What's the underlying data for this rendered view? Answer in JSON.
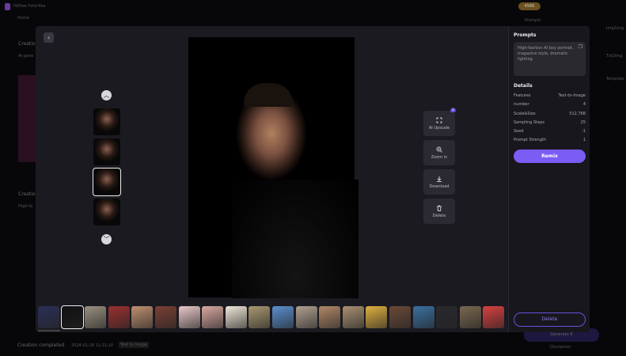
{
  "app": {
    "title": "HitPaw FotorPea",
    "coins": "4566",
    "home": "Home",
    "prompts_bg": "Prompts",
    "img2img": "Img2img",
    "txt2img": "Txt2img",
    "template": "Template",
    "generate": "Generate",
    "generate_cost": "8",
    "disclaimer": "Disclaimer",
    "creation1": "Creation",
    "creation1_sub": "AI-gene",
    "creation2": "Creation",
    "creation2_sub": "High-fa",
    "status": "Creation completed",
    "status_time": "2024-01-28 11:21:10",
    "status_tag": "Text to Image"
  },
  "viewer": {
    "actions": [
      {
        "label": "AI Upscale",
        "icon": "expand-icon",
        "badge": "2"
      },
      {
        "label": "Zoom in",
        "icon": "zoom-in-icon"
      },
      {
        "label": "Download",
        "icon": "download-icon"
      },
      {
        "label": "Delete",
        "icon": "trash-icon"
      }
    ],
    "thumbnails_selected": 2,
    "strip_colors": [
      "#2b2f55",
      "#111111",
      "#9a9080",
      "#9b3030",
      "#c09070",
      "#7a4035",
      "#e8c8c8",
      "#d8a8a0",
      "#f0e8d8",
      "#a89870",
      "#5a90d0",
      "#b0a090",
      "#b08868",
      "#a89070",
      "#e0b040",
      "#6a4a38",
      "#3a70a0",
      "#2a2a2e",
      "#7a6850",
      "#d84040"
    ],
    "strip_selected": 1
  },
  "panel": {
    "prompts_title": "Prompts",
    "prompt_text": "High-fashion AI boy portrait, magazine style, dramatic lighting",
    "details_title": "Details",
    "details": [
      {
        "k": "Features",
        "v": "Text-to-Image"
      },
      {
        "k": "number",
        "v": "4"
      },
      {
        "k": "Scale&Size",
        "v": "512,768"
      },
      {
        "k": "Sampling Steps",
        "v": "25"
      },
      {
        "k": "Seed",
        "v": "-1"
      },
      {
        "k": "Prompt Strength",
        "v": "1"
      }
    ],
    "remix": "Remix",
    "delete": "Delete",
    "accent": "#7b5cf5"
  }
}
